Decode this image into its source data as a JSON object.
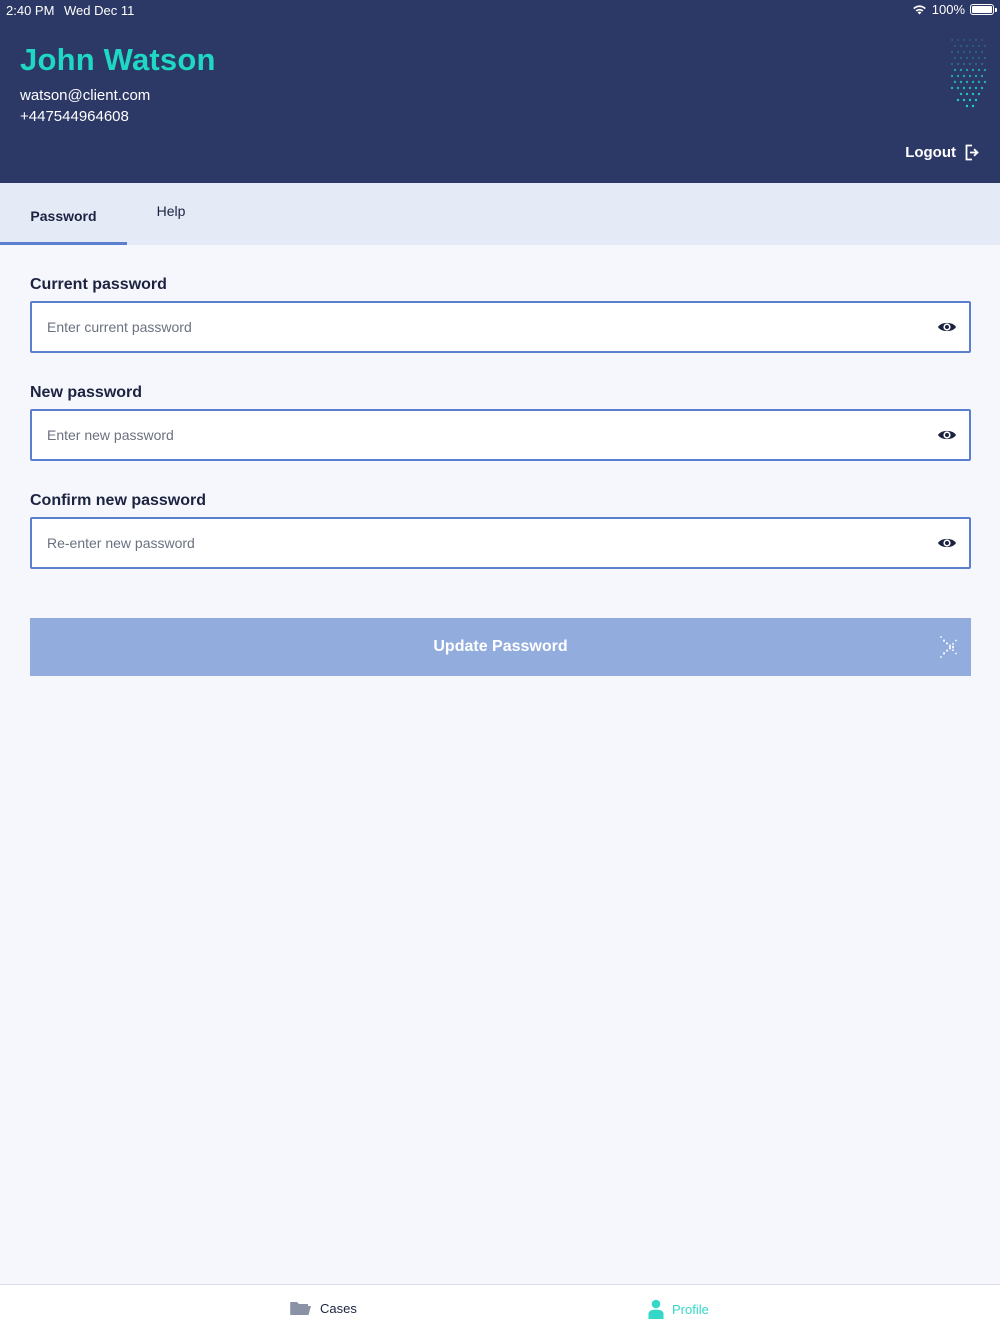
{
  "status_bar": {
    "time": "2:40 PM",
    "date": "Wed Dec 11",
    "battery": "100%"
  },
  "user": {
    "name": "John Watson",
    "email": "watson@client.com",
    "phone": "+447544964608"
  },
  "header": {
    "logout_label": "Logout"
  },
  "tabs": [
    {
      "label": "Password",
      "active": true
    },
    {
      "label": "Help",
      "active": false
    }
  ],
  "form": {
    "current": {
      "label": "Current password",
      "placeholder": "Enter current password"
    },
    "new": {
      "label": "New password",
      "placeholder": "Enter new password"
    },
    "confirm": {
      "label": "Confirm new password",
      "placeholder": "Re-enter new password"
    },
    "submit_label": "Update Password"
  },
  "bottom_nav": [
    {
      "label": "Cases",
      "icon": "folder-icon",
      "active": false
    },
    {
      "label": "Profile",
      "icon": "person-icon",
      "active": true
    }
  ],
  "colors": {
    "header_bg": "#2c3865",
    "accent_teal": "#1fd8c4",
    "input_border": "#5b7fcf",
    "button_bg": "#92acdd",
    "tabs_bg": "#e4eaf6",
    "page_bg": "#f5f7fc"
  }
}
